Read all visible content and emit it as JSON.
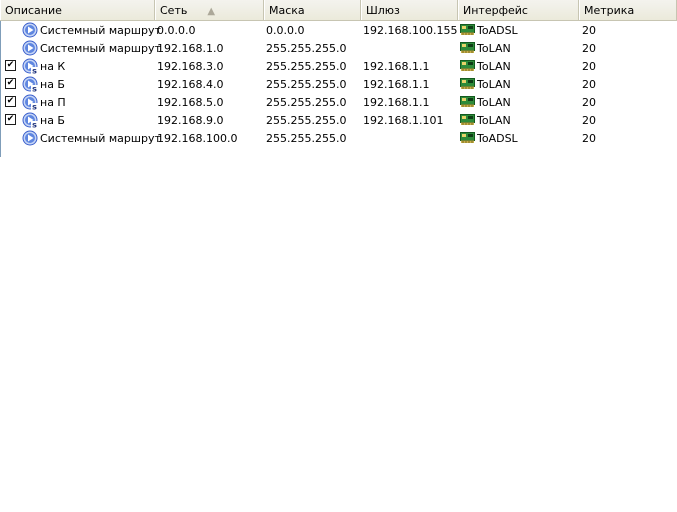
{
  "columns": [
    {
      "label": "Описание"
    },
    {
      "label": "Сеть",
      "sort": "▲"
    },
    {
      "label": "Маска"
    },
    {
      "label": "Шлюз"
    },
    {
      "label": "Интерфейс"
    },
    {
      "label": "Метрика"
    }
  ],
  "rows": [
    {
      "check": "",
      "icon": "system-route-icon",
      "description": "Системный маршрут",
      "network": "0.0.0.0",
      "mask": "0.0.0.0",
      "gateway": "192.168.100.155",
      "interface": "ToADSL",
      "metric": "20"
    },
    {
      "check": "",
      "icon": "system-route-icon",
      "description": "Системный маршрут",
      "network": "192.168.1.0",
      "mask": "255.255.255.0",
      "gateway": "",
      "interface": "ToLAN",
      "metric": "20"
    },
    {
      "check": "✔",
      "icon": "static-route-icon",
      "description": "на К",
      "network": "192.168.3.0",
      "mask": "255.255.255.0",
      "gateway": "192.168.1.1",
      "interface": "ToLAN",
      "metric": "20"
    },
    {
      "check": "✔",
      "icon": "static-route-icon",
      "description": "на Б",
      "network": "192.168.4.0",
      "mask": "255.255.255.0",
      "gateway": "192.168.1.1",
      "interface": "ToLAN",
      "metric": "20"
    },
    {
      "check": "✔",
      "icon": "static-route-icon",
      "description": "на П",
      "network": "192.168.5.0",
      "mask": "255.255.255.0",
      "gateway": "192.168.1.1",
      "interface": "ToLAN",
      "metric": "20"
    },
    {
      "check": "✔",
      "icon": "static-route-icon",
      "description": "на Б",
      "network": "192.168.9.0",
      "mask": "255.255.255.0",
      "gateway": "192.168.1.101",
      "interface": "ToLAN",
      "metric": "20"
    },
    {
      "check": "",
      "icon": "system-route-icon",
      "description": "Системный маршрут",
      "network": "192.168.100.0",
      "mask": "255.255.255.0",
      "gateway": "",
      "interface": "ToADSL",
      "metric": "20"
    }
  ],
  "colors": {
    "header_bg": "#ebeadb",
    "route_icon": "#3a5fcd",
    "nic_icon": "#2e8b3a"
  }
}
